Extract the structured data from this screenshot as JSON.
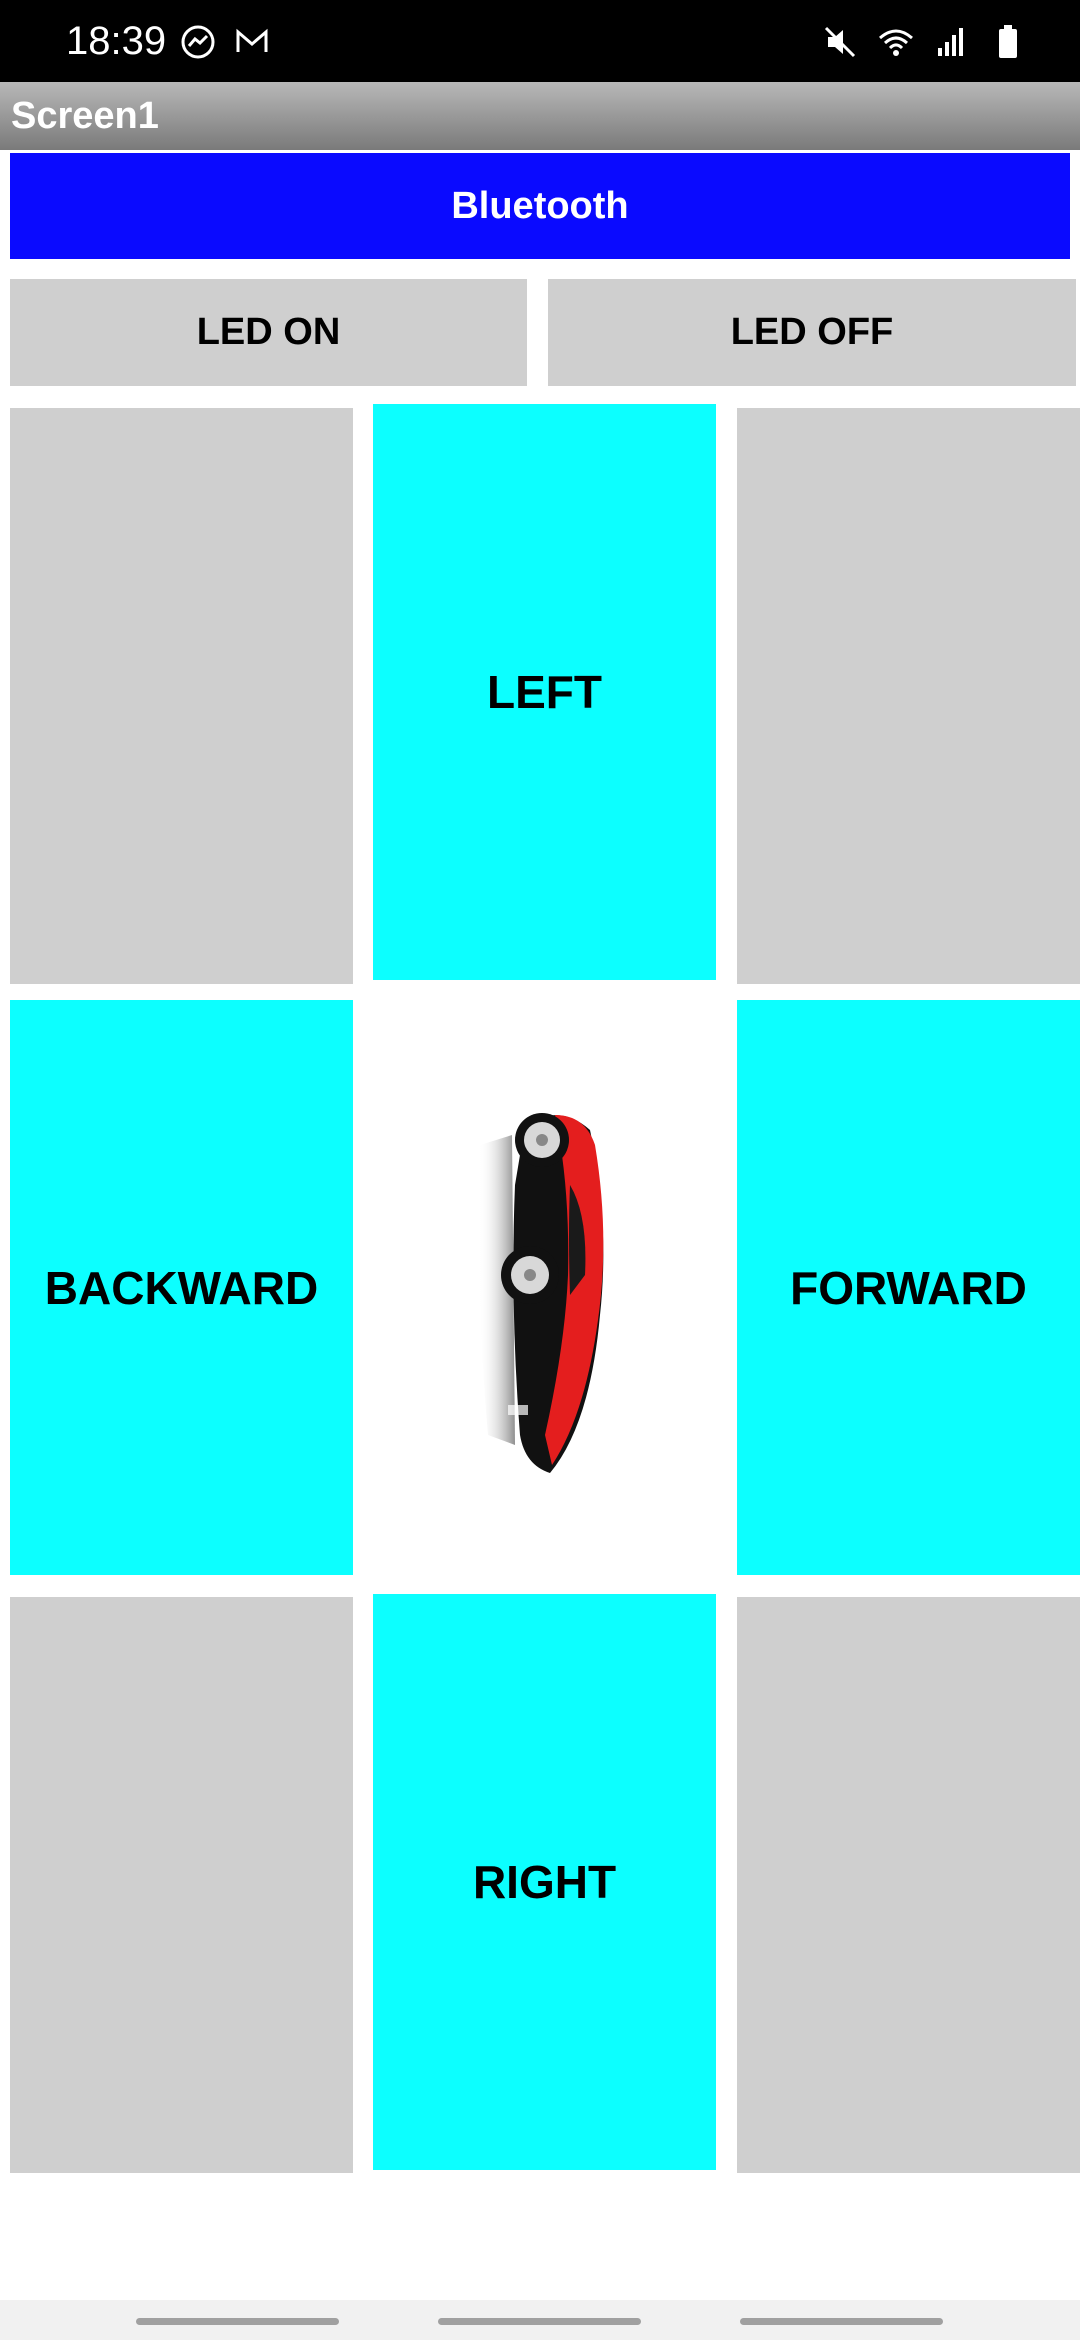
{
  "status_bar": {
    "time": "18:39",
    "left_icons": [
      "messenger-icon",
      "gmail-icon"
    ],
    "right_icons": [
      "mute-icon",
      "wifi-icon",
      "signal-icon",
      "battery-icon"
    ]
  },
  "app": {
    "title": "Screen1"
  },
  "buttons": {
    "bluetooth": "Bluetooth",
    "led_on": "LED ON",
    "led_off": "LED OFF",
    "left": "LEFT",
    "backward": "BACKWARD",
    "forward": "FORWARD",
    "right": "RIGHT"
  },
  "colors": {
    "bluetooth_button": "#0a0aff",
    "direction_buttons": "#0cffff",
    "idle_cells": "#cfcfcf",
    "title_bar": "#8c8c8c",
    "car_body": "#e41e1e"
  },
  "center_image": {
    "icon": "red-sports-car-icon"
  },
  "nav_bar": {
    "items": [
      "nav-pill-left",
      "nav-pill-center",
      "nav-pill-right"
    ]
  }
}
